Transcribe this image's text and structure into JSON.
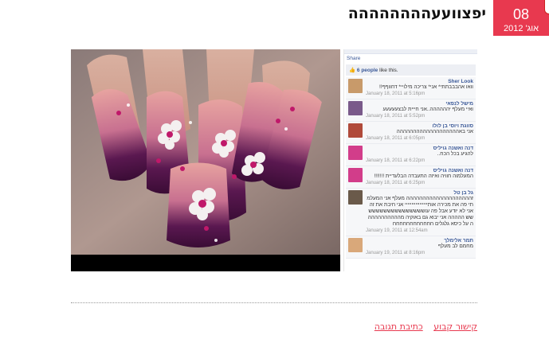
{
  "date_badge": {
    "day": "08",
    "month": "אוג' 2012"
  },
  "post": {
    "title": "יפצוועעהההההההה"
  },
  "facebook": {
    "share_label": "Share",
    "likes_count": "6 people",
    "likes_suffix": "like this.",
    "comments": [
      {
        "author": "Sher Look",
        "text": "וואו אהבבבתתי* אני* צריכה מילויי* דחווףף!!",
        "time": "January 18, 2011 at 5:16pm",
        "avatar_color": "#c89a6a"
      },
      {
        "author": "מישל לנפאי",
        "text": "ואיי מעלף יהההההה..אני חייית לבצעעעעע",
        "time": "January 18, 2011 at 5:52pm",
        "avatar_color": "#7a5a8a"
      },
      {
        "author": "סווגת ויוסי בן לולו",
        "text": "אני באההההההההההההההההההה",
        "time": "January 18, 2011 at 6:05pm",
        "avatar_color": "#b04a3a"
      },
      {
        "author": "דנה ואשנה גויליס",
        "text": "להגיע בכל הכח..",
        "time": "January 18, 2011 at 6:22pm",
        "avatar_color": "#d23d8a"
      },
      {
        "author": "דנה ואשנה גויליס",
        "text": "המעלמוה חוויה ואיזה התעבדה הבלעדיית !!!!!!!",
        "time": "January 18, 2011 at 6:25pm",
        "avatar_color": "#d23d8a"
      },
      {
        "author": "גל בן טל",
        "text": "זהההההההההההההההההההה מעלף אני המעלמתי פה את מכירה אותייייייייייייייייי אני חיבת את זה אני לא יודע אבל פה עוששששששששששששששששש ההההה אני יבוא גם באוקיה מההההההההההה על כיסא גלגלים חחחחחחחחחחחח",
        "time": "January 19, 2011 at 12:54am",
        "avatar_color": "#6a5a4a"
      },
      {
        "author": "תמר אלימלך",
        "text": "מחמם לב מעלף",
        "time": "January 19, 2011 at 8:16pm",
        "avatar_color": "#d9a87a"
      }
    ]
  },
  "footer": {
    "permalink_label": "קישור קבוע",
    "comment_label": "כתיבת תגובה"
  },
  "colors": {
    "accent": "#e8394f",
    "facebook_blue": "#3b5998",
    "nail_purple": "#5a1850"
  }
}
